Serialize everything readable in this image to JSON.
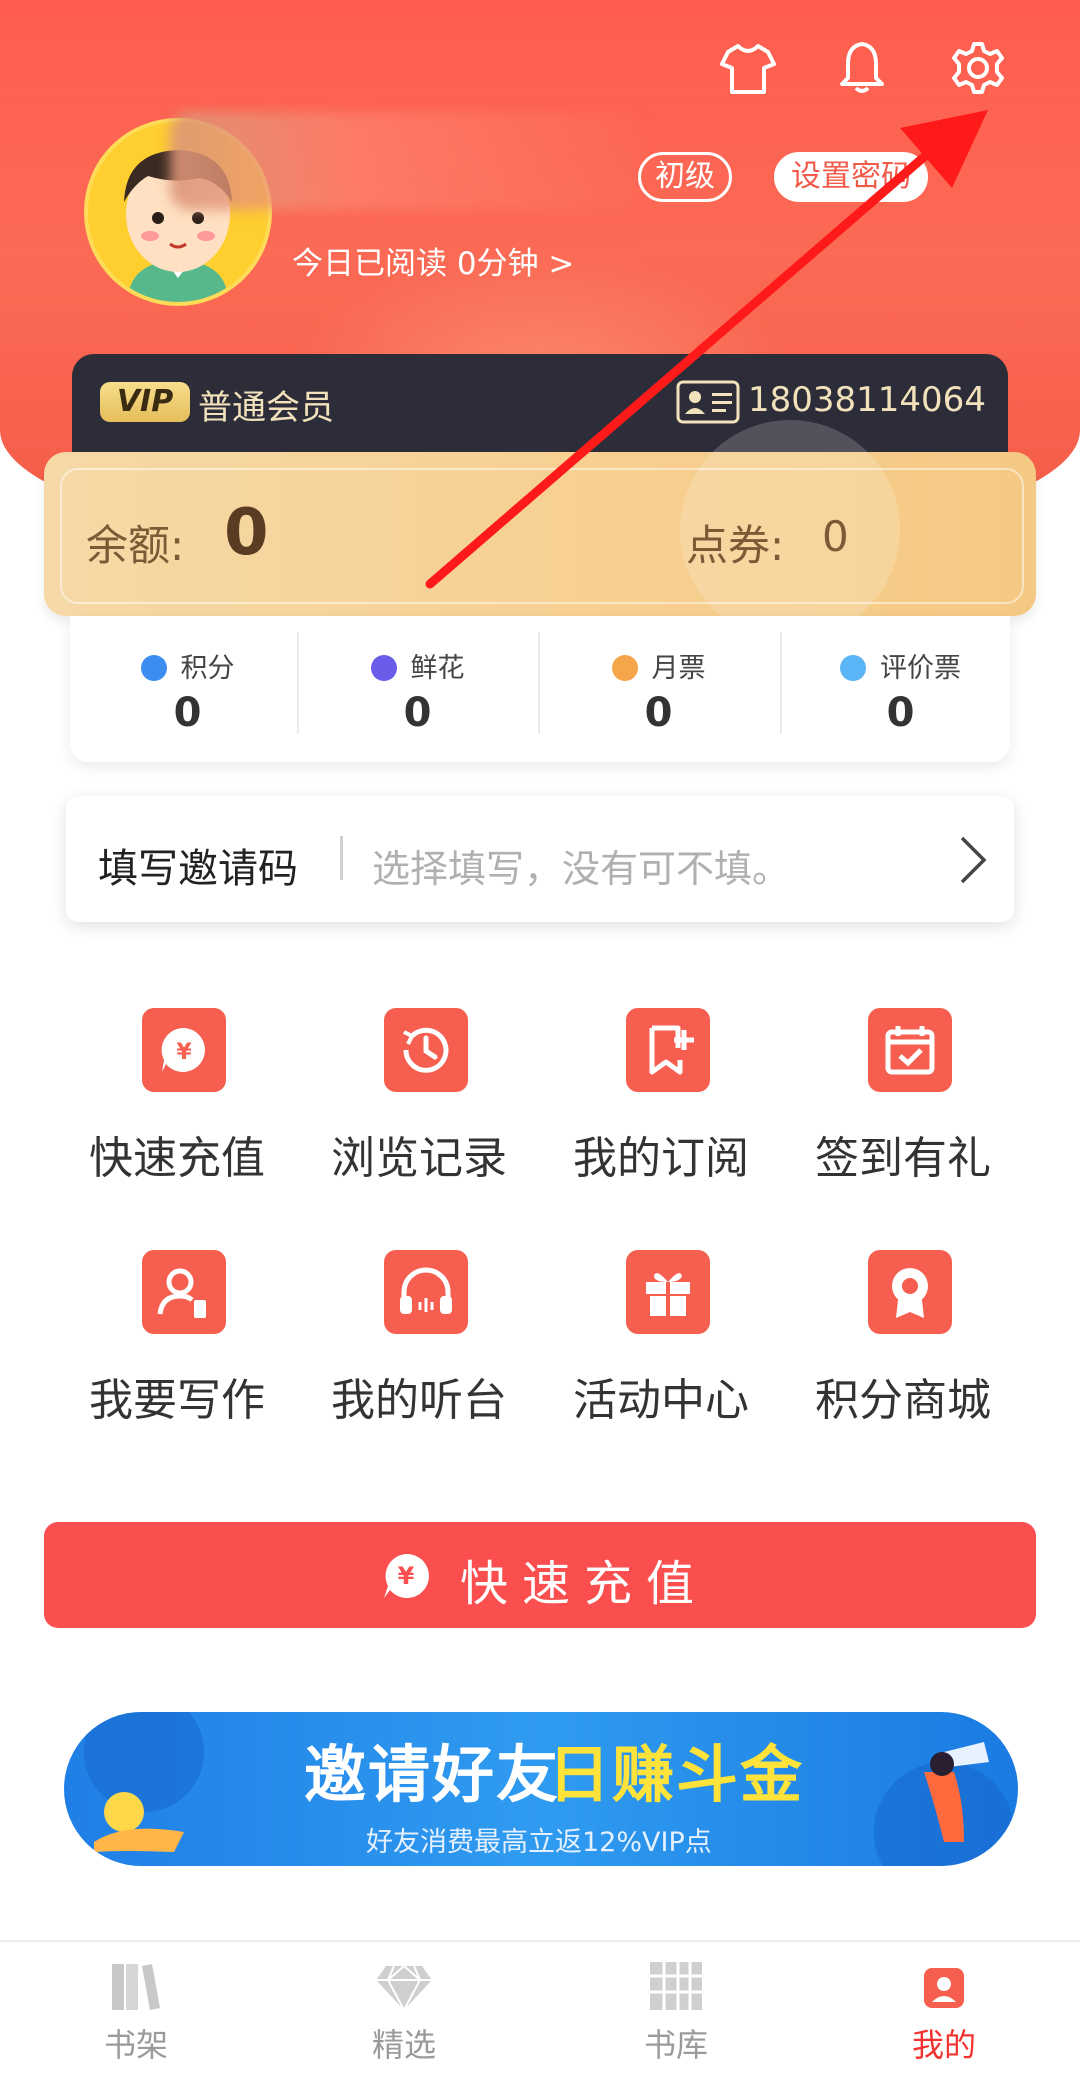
{
  "header": {
    "level_badge": "初级",
    "set_password": "设置密码",
    "reading_today": "今日已阅读 0分钟 >"
  },
  "vip": {
    "badge": "VIP",
    "tier": "普通会员",
    "phone": "18038114064"
  },
  "balance": {
    "label": "余额:",
    "value": "0",
    "coupon_label": "点券:",
    "coupon_value": "0"
  },
  "stats": [
    {
      "label": "积分",
      "value": "0",
      "color": "#3b8ef0"
    },
    {
      "label": "鲜花",
      "value": "0",
      "color": "#6a5be8"
    },
    {
      "label": "月票",
      "value": "0",
      "color": "#f5a64a"
    },
    {
      "label": "评价票",
      "value": "0",
      "color": "#5ab4f5"
    }
  ],
  "invite": {
    "label": "填写邀请码",
    "placeholder": "选择填写，没有可不填。"
  },
  "grid": [
    {
      "label": "快速充值",
      "icon": "recharge-icon"
    },
    {
      "label": "浏览记录",
      "icon": "history-icon"
    },
    {
      "label": "我的订阅",
      "icon": "subscription-icon"
    },
    {
      "label": "签到有礼",
      "icon": "checkin-icon"
    },
    {
      "label": "我要写作",
      "icon": "writer-icon"
    },
    {
      "label": "我的听台",
      "icon": "headphones-icon"
    },
    {
      "label": "活动中心",
      "icon": "gift-icon"
    },
    {
      "label": "积分商城",
      "icon": "points-mall-icon"
    }
  ],
  "recharge_button": "快速充值",
  "banner": {
    "title_white": "邀请好友",
    "title_yellow": "日赚斗金",
    "subtitle": "好友消费最高立返12%VIP点"
  },
  "tabs": [
    {
      "label": "书架",
      "active": false
    },
    {
      "label": "精选",
      "active": false
    },
    {
      "label": "书库",
      "active": false
    },
    {
      "label": "我的",
      "active": true
    }
  ],
  "colors": {
    "header_red": "#ff5d4f",
    "accent_red": "#fa4f4e",
    "vip_gold": "#f2e2bb",
    "annotation_arrow": "#ff1a1a"
  }
}
